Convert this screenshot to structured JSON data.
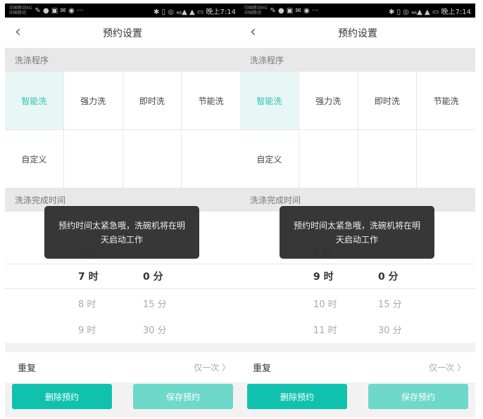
{
  "phones": [
    {
      "status": {
        "carrier1": "中国移动4G",
        "carrier2": "中国移动",
        "icons": "✎ ● ▣ ✉ ◉ ···",
        "right": "✱ ▯ ◎ ₄₆▲ ▲ ▭ 晚上7:14"
      },
      "nav": {
        "back": "‹",
        "title": "预约设置"
      },
      "program_header": "洗涤程序",
      "programs": [
        "智能洗",
        "强力洗",
        "即时洗",
        "节能洗",
        "自定义",
        "",
        "",
        ""
      ],
      "selected_program": "智能洗",
      "time_header": "洗涤完成时间",
      "picker": [
        {
          "h": "6 时",
          "m": ""
        },
        {
          "h": "7 时",
          "m": "0 分"
        },
        {
          "h": "8 时",
          "m": "15 分"
        },
        {
          "h": "9 时",
          "m": "30 分"
        }
      ],
      "repeat": {
        "label": "重复",
        "value": "仅一次 〉"
      },
      "buttons": {
        "delete": "删除预约",
        "save": "保存预约"
      },
      "toast": "预约时间太紧急哦，洗碗机将在明天启动工作"
    },
    {
      "status": {
        "carrier1": "中国移动4G",
        "carrier2": "中国移动",
        "icons": "✎ ● ▣ ✉ ◉ ···",
        "right": "✱ ▯ ◎ ₄₆▲ ▲ ▭ 晚上7:14"
      },
      "nav": {
        "back": "‹",
        "title": "预约设置"
      },
      "program_header": "洗涤程序",
      "programs": [
        "智能洗",
        "强力洗",
        "即时洗",
        "节能洗",
        "自定义",
        "",
        "",
        ""
      ],
      "selected_program": "智能洗",
      "time_header": "洗涤完成时间",
      "picker": [
        {
          "h": "8 时",
          "m": ""
        },
        {
          "h": "9 时",
          "m": "0 分"
        },
        {
          "h": "10 时",
          "m": "15 分"
        },
        {
          "h": "11 时",
          "m": "30 分"
        }
      ],
      "repeat": {
        "label": "重复",
        "value": "仅一次 〉"
      },
      "buttons": {
        "delete": "删除预约",
        "save": "保存预约"
      },
      "toast": "预约时间太紧急哦，洗碗机将在明天启动工作"
    }
  ]
}
